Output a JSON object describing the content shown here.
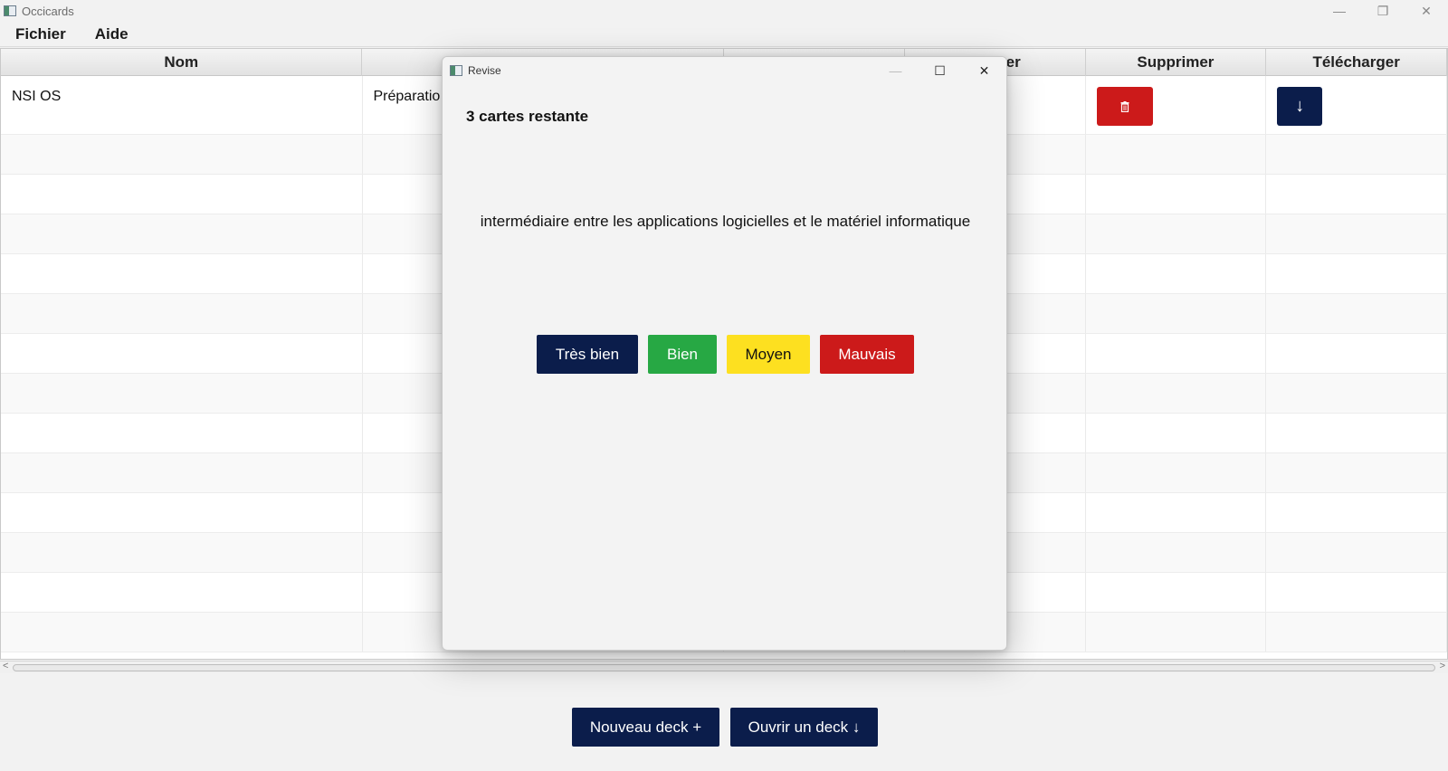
{
  "window": {
    "title": "Occicards",
    "controls": {
      "minimize": "—",
      "restore": "❐",
      "close": "✕"
    }
  },
  "menu": {
    "items": [
      "Fichier",
      "Aide"
    ]
  },
  "table": {
    "columns": [
      "Nom",
      "",
      "",
      "er",
      "Supprimer",
      "Télécharger"
    ],
    "rows": [
      {
        "name": "NSI OS",
        "description": "Préparatio"
      }
    ]
  },
  "dialog": {
    "title": "Revise",
    "controls": {
      "minimize": "—",
      "maximize": "☐",
      "close": "✕"
    },
    "remaining": "3 cartes restante",
    "question": "intermédiaire entre les applications logicielles et le matériel informatique",
    "buttons": [
      "Très bien",
      "Bien",
      "Moyen",
      "Mauvais"
    ]
  },
  "bottom": {
    "new_deck": "Nouveau deck +",
    "open_deck": "Ouvrir un deck ↓"
  },
  "icons": {
    "delete": "trash-icon",
    "download": "↓"
  },
  "colors": {
    "navy": "#0b1d4b",
    "green": "#27a844",
    "yellow": "#fde020",
    "red": "#cc1a1a"
  }
}
